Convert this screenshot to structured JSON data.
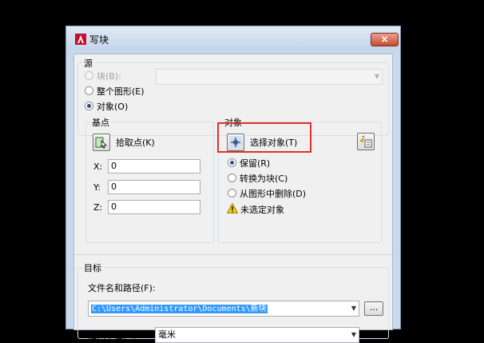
{
  "window": {
    "title": "写块",
    "close_symbol": "×",
    "app_icon_letter": "A"
  },
  "source": {
    "label": "源",
    "options": [
      {
        "label": "块(B):",
        "checked": false,
        "enabled": false
      },
      {
        "label": "整个图形(E)",
        "checked": false,
        "enabled": true
      },
      {
        "label": "对象(O)",
        "checked": true,
        "enabled": true
      }
    ],
    "block_combo_value": ""
  },
  "base_point": {
    "label": "基点",
    "pick_button_label": "拾取点(K)",
    "x_label": "X:",
    "x_value": "0",
    "y_label": "Y:",
    "y_value": "0",
    "z_label": "Z:",
    "z_value": "0"
  },
  "objects": {
    "label": "对象",
    "select_button_label": "选择对象(T)",
    "options": [
      {
        "label": "保留(R)",
        "checked": true
      },
      {
        "label": "转换为块(C)",
        "checked": false
      },
      {
        "label": "从图形中删除(D)",
        "checked": false
      }
    ],
    "warning_text": "未选定对象"
  },
  "target": {
    "label": "目标",
    "filename_label": "文件名和路径(F):",
    "filename_value": "C:\\Users\\Administrator\\Documents\\新块",
    "browse_label": "...",
    "units_label": "插入单位(U):",
    "units_value": "毫米"
  },
  "colors": {
    "accent": "#3399ff",
    "highlight": "#e0302b",
    "title_bar": "#c9d9ec"
  },
  "icons": [
    "autocad-logo-icon",
    "close-icon",
    "pick-point-icon",
    "select-objects-icon",
    "quick-select-icon",
    "warning-icon",
    "chevron-down-icon"
  ]
}
